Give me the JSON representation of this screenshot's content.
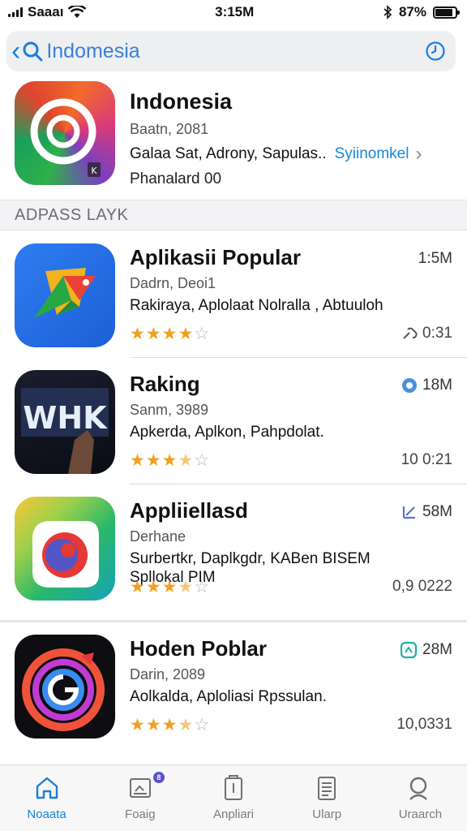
{
  "status_bar": {
    "carrier": "Saaaı",
    "time": "3:15M",
    "battery": "87%",
    "battery_level": 0.87
  },
  "search": {
    "query": "Indomesia"
  },
  "featured": {
    "title": "Indonesia",
    "subtitle": "Baatn, 2081",
    "description": "Galaa Sat, Adrony, Sapulas..",
    "link": "Syiinomkel",
    "extra": "Phanalard 00"
  },
  "section": {
    "title": "ADPASS LAYK"
  },
  "apps": [
    {
      "title": "Aplikasii Popular",
      "subtitle": "Dadrn, Deoi1",
      "description": "Rakiraya, Aplolaat Nolralla , Abtuuloh",
      "size": "1:5M",
      "time": "0:31",
      "stars": 4
    },
    {
      "title": "Raking",
      "subtitle": "Sanm, 3989",
      "description": "Apkerda, Aplkon, Pahpdolat.",
      "size": "18M",
      "time": "10 0:21",
      "stars": 3.5
    },
    {
      "title": "Appliiellasd",
      "subtitle": "Derhane",
      "description": "Surbertkr, Daplkgdr, KABen BISEM",
      "description2": "Spllokal PIM",
      "size": "58M",
      "time": "0,9 0222",
      "stars": 3.5
    },
    {
      "title": "Hoden Poblar",
      "subtitle": "Darin, 2089",
      "description": "Aolkalda, Aploliasi Rpssulan.",
      "size": "28M",
      "time": "10,0331",
      "stars": 3.5
    }
  ],
  "tabs": [
    {
      "label": "Noaata",
      "icon": "home-icon",
      "active": true
    },
    {
      "label": "Foaig",
      "icon": "today-icon",
      "badge": "8"
    },
    {
      "label": "Anpliari",
      "icon": "apps-icon"
    },
    {
      "label": "Ularp",
      "icon": "updates-icon"
    },
    {
      "label": "Uraarch",
      "icon": "search-icon"
    }
  ],
  "colors": {
    "accent": "#1a7fe0",
    "star": "#f0a020"
  }
}
